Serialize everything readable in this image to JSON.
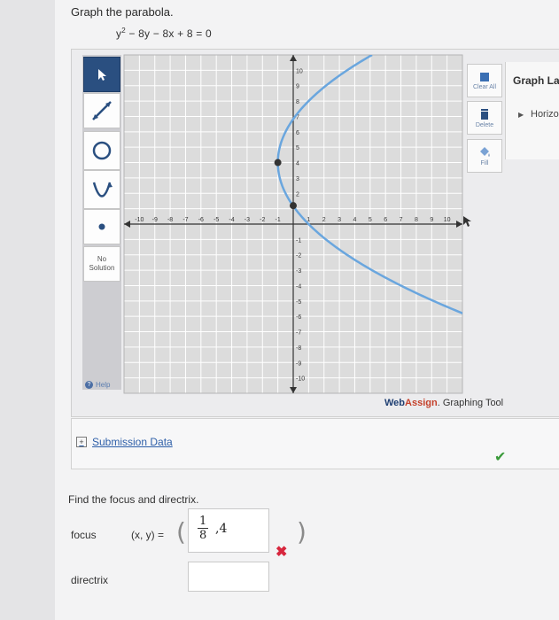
{
  "heading": "Graph the parabola.",
  "equation": {
    "base": "y",
    "sup": "2",
    "rest": " − 8y − 8x + 8 = 0"
  },
  "toolbar": {
    "no_solution_line1": "No",
    "no_solution_line2": "Solution",
    "help": "Help"
  },
  "graph": {
    "x_ticks": [
      "-10",
      "-9",
      "-8",
      "-7",
      "-6",
      "-5",
      "-4",
      "-3",
      "-2",
      "-1",
      "1",
      "2",
      "3",
      "4",
      "5",
      "6",
      "7",
      "8",
      "9",
      "10"
    ],
    "y_ticks": [
      "10",
      "9",
      "8",
      "7",
      "6",
      "5",
      "4",
      "3",
      "2",
      "-1",
      "-2",
      "-3",
      "-4",
      "-5",
      "-6",
      "-7",
      "-8",
      "-9",
      "-10"
    ],
    "xlim": [
      -11,
      11
    ],
    "ylim": [
      -11,
      11
    ],
    "curve": "x = (y^2 - 8y + 8)/8",
    "vertex": [
      -1,
      4
    ],
    "points": [
      [
        -1,
        4
      ],
      [
        0,
        1.2
      ]
    ],
    "curve_color": "#6aa6de",
    "point_color": "#333333"
  },
  "right_tools": {
    "clear_all": "Clear All",
    "delete": "Delete",
    "fill": "Fill"
  },
  "graph_layers": {
    "title": "Graph Lay",
    "item": "Horizo"
  },
  "watermark": {
    "brand1": "Web",
    "brand2": "Assign",
    "rest": ". Graphing Tool"
  },
  "submission": {
    "label": "Submission Data"
  },
  "question": {
    "prompt": "Find the focus and directrix.",
    "focus_label": "focus",
    "xy_label": "(x, y)  =",
    "focus_num": "1",
    "focus_den": "8",
    "focus_rest": ",4",
    "directrix_label": "directrix"
  },
  "colors": {
    "accent": "#2a4f80",
    "correct": "#3a9a3a",
    "wrong": "#d7263d"
  }
}
